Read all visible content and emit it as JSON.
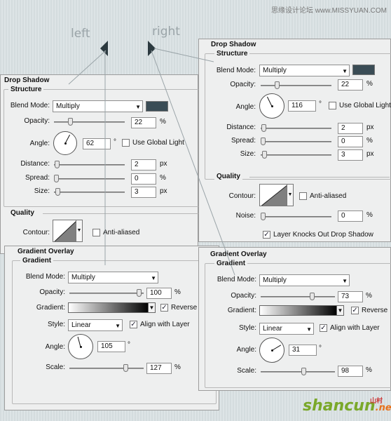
{
  "watermark": "思缘设计论坛 www.MISSYUAN.COM",
  "labels": {
    "left": "left",
    "right": "right"
  },
  "swatch_color": "#3a4c55",
  "left_drop_shadow": {
    "title": "Drop Shadow",
    "group_structure": "Structure",
    "blend_mode_label": "Blend Mode:",
    "blend_mode": "Multiply",
    "opacity_label": "Opacity:",
    "opacity": "22",
    "opacity_unit": "%",
    "angle_label": "Angle:",
    "angle": "62",
    "angle_unit": "°",
    "global_light_label": "Use Global Light",
    "distance_label": "Distance:",
    "distance": "2",
    "distance_unit": "px",
    "spread_label": "Spread:",
    "spread": "0",
    "spread_unit": "%",
    "size_label": "Size:",
    "size": "3",
    "size_unit": "px",
    "group_quality": "Quality",
    "contour_label": "Contour:",
    "anti_aliased_label": "Anti-aliased"
  },
  "right_drop_shadow": {
    "title": "Drop Shadow",
    "group_structure": "Structure",
    "blend_mode_label": "Blend Mode:",
    "blend_mode": "Multiply",
    "opacity_label": "Opacity:",
    "opacity": "22",
    "opacity_unit": "%",
    "angle_label": "Angle:",
    "angle": "116",
    "angle_unit": "°",
    "global_light_label": "Use Global Light",
    "distance_label": "Distance:",
    "distance": "2",
    "distance_unit": "px",
    "spread_label": "Spread:",
    "spread": "0",
    "spread_unit": "%",
    "size_label": "Size:",
    "size": "3",
    "size_unit": "px",
    "group_quality": "Quality",
    "contour_label": "Contour:",
    "anti_aliased_label": "Anti-aliased",
    "noise_label": "Noise:",
    "noise": "0",
    "noise_unit": "%",
    "knockout_label": "Layer Knocks Out Drop Shadow"
  },
  "left_gradient_overlay": {
    "title": "Gradient Overlay",
    "group_gradient": "Gradient",
    "blend_mode_label": "Blend Mode:",
    "blend_mode": "Multiply",
    "opacity_label": "Opacity:",
    "opacity": "100",
    "opacity_unit": "%",
    "gradient_label": "Gradient:",
    "reverse_label": "Reverse",
    "style_label": "Style:",
    "style": "Linear",
    "align_label": "Align with Layer",
    "angle_label": "Angle:",
    "angle": "105",
    "angle_unit": "°",
    "scale_label": "Scale:",
    "scale": "127",
    "scale_unit": "%"
  },
  "right_gradient_overlay": {
    "title": "Gradient Overlay",
    "group_gradient": "Gradient",
    "blend_mode_label": "Blend Mode:",
    "blend_mode": "Multiply",
    "opacity_label": "Opacity:",
    "opacity": "73",
    "opacity_unit": "%",
    "gradient_label": "Gradient:",
    "reverse_label": "Reverse",
    "style_label": "Style:",
    "style": "Linear",
    "align_label": "Align with Layer",
    "angle_label": "Angle:",
    "angle": "31",
    "angle_unit": "°",
    "scale_label": "Scale:",
    "scale": "98",
    "scale_unit": "%"
  },
  "logo": {
    "main": "shancun",
    "suffix": ".net",
    "cn": "山村"
  }
}
